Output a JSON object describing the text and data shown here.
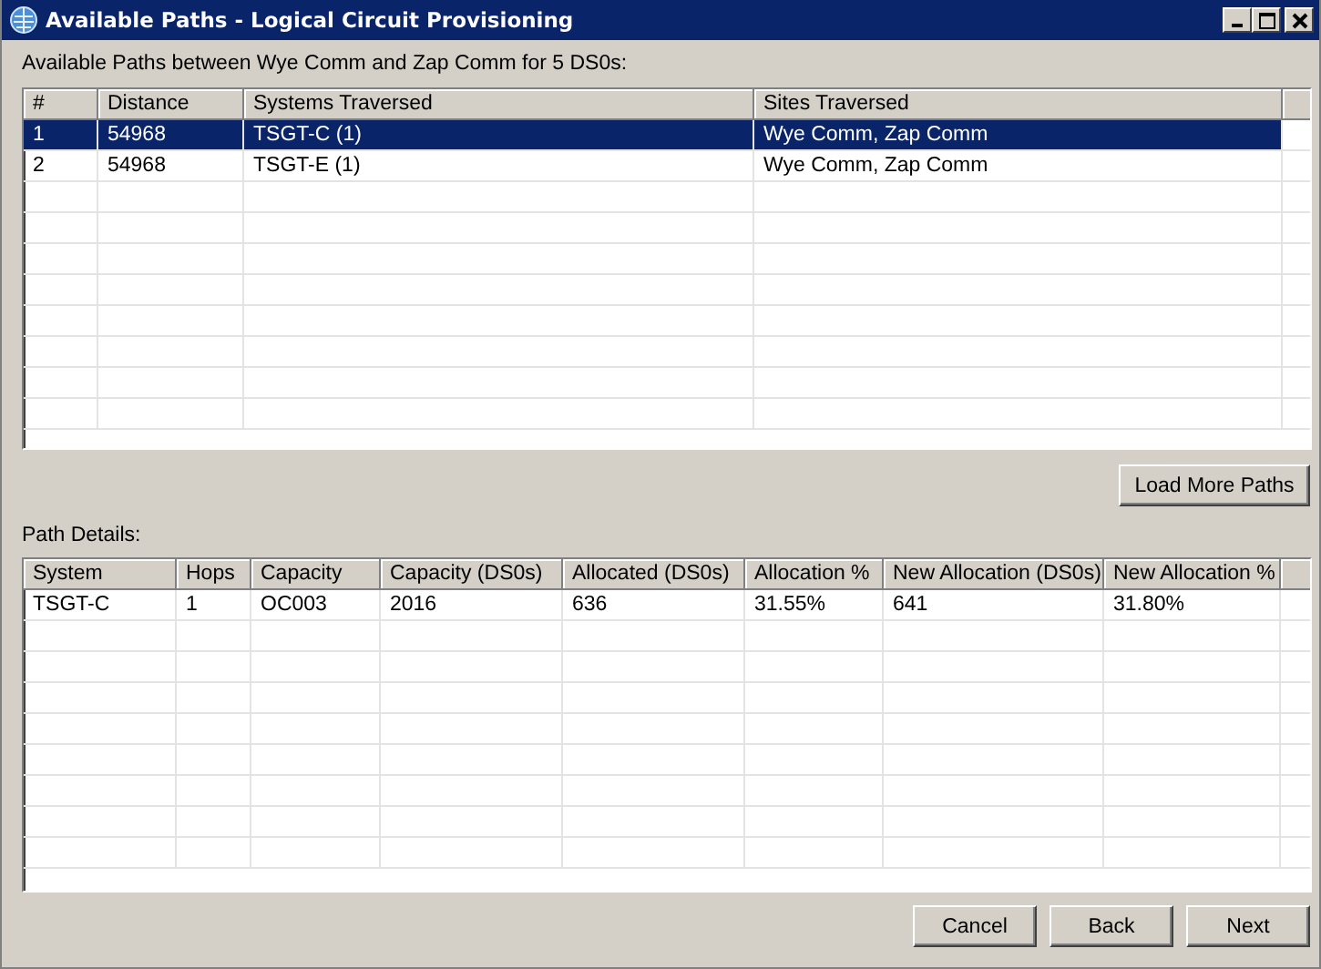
{
  "window": {
    "title": "Available Paths - Logical Circuit Provisioning"
  },
  "paths_label": "Available Paths between Wye Comm and Zap Comm for 5 DS0s:",
  "paths_table": {
    "columns": [
      "#",
      "Distance",
      "Systems Traversed",
      "Sites Traversed"
    ],
    "rows": [
      {
        "cells": [
          "1",
          "54968",
          "TSGT-C (1)",
          "Wye Comm, Zap Comm"
        ],
        "selected": true
      },
      {
        "cells": [
          "2",
          "54968",
          "TSGT-E (1)",
          "Wye Comm, Zap Comm"
        ],
        "selected": false
      }
    ]
  },
  "load_more_button": "Load More Paths",
  "details_label": "Path Details:",
  "details_table": {
    "columns": [
      "System",
      "Hops",
      "Capacity",
      "Capacity (DS0s)",
      "Allocated (DS0s)",
      "Allocation %",
      "New Allocation (DS0s)",
      "New Allocation %"
    ],
    "rows": [
      {
        "cells": [
          "TSGT-C",
          "1",
          "OC003",
          "2016",
          "636",
          "31.55%",
          "641",
          "31.80%"
        ],
        "selected": false
      }
    ]
  },
  "buttons": [
    "Cancel",
    "Back",
    "Next"
  ]
}
